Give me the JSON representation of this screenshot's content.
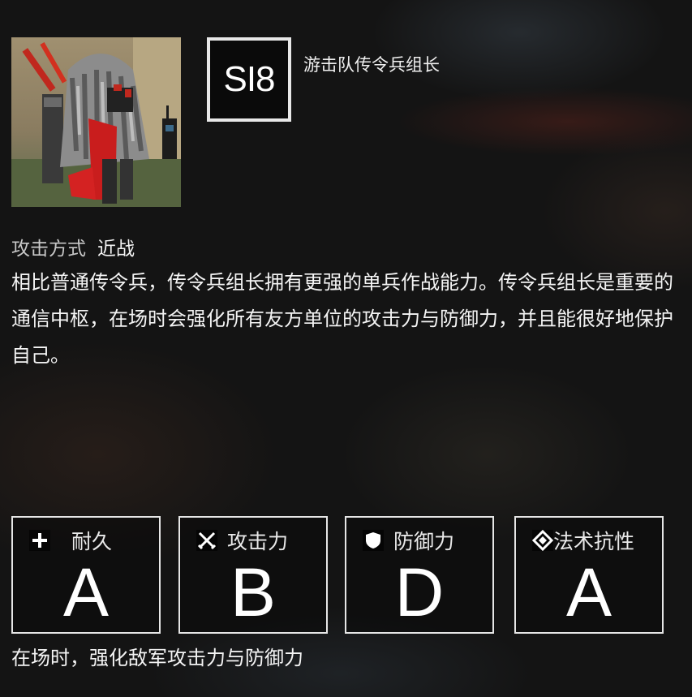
{
  "enemy": {
    "code": "SI8",
    "name": "游击队传令兵组长"
  },
  "attack": {
    "label": "攻击方式",
    "value": "近战"
  },
  "description": "相比普通传令兵，传令兵组长拥有更强的单兵作战能力。传令兵组长是重要的通信中枢，在场时会强化所有友方单位的攻击力与防御力，并且能很好地保护自己。",
  "stats": [
    {
      "label": "耐久",
      "grade": "A",
      "icon": "plus-icon"
    },
    {
      "label": "攻击力",
      "grade": "B",
      "icon": "crossed-swords-icon"
    },
    {
      "label": "防御力",
      "grade": "D",
      "icon": "shield-icon"
    },
    {
      "label": "法术抗性",
      "grade": "A",
      "icon": "diamond-icon"
    }
  ],
  "ability": "在场时，强化敌军攻击力与防御力"
}
